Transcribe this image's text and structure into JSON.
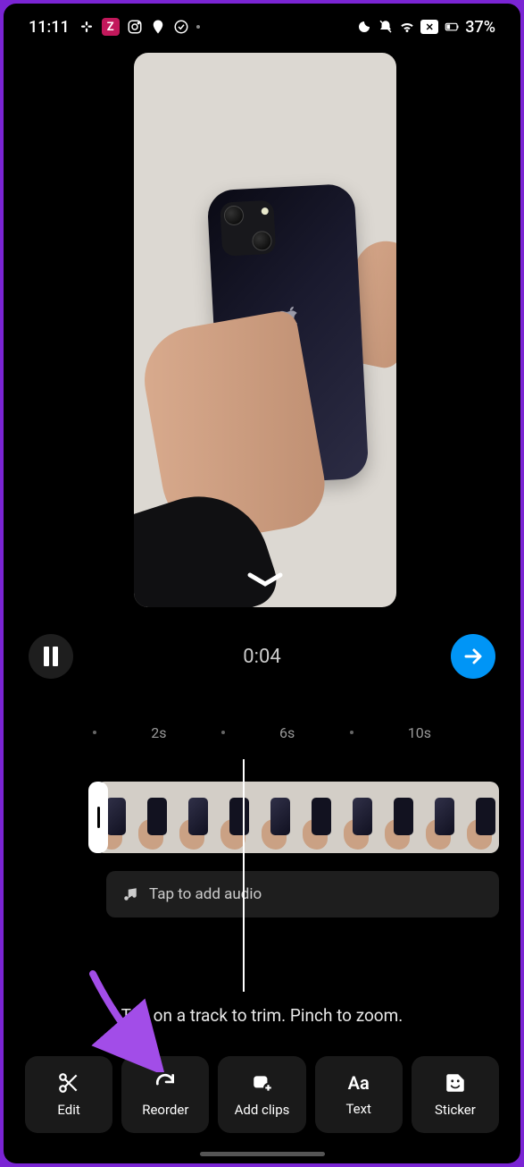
{
  "statusbar": {
    "time": "11:11",
    "z_label": "Z",
    "battery_text": "37%"
  },
  "playback": {
    "current_time": "0:04"
  },
  "ruler": {
    "marks": [
      "2s",
      "6s",
      "10s"
    ]
  },
  "audio": {
    "prompt": "Tap to add audio"
  },
  "hint": "Tap on a track to trim. Pinch to zoom.",
  "tools": {
    "edit": "Edit",
    "reorder": "Reorder",
    "add_clips": "Add clips",
    "text": "Text",
    "sticker": "Sticker"
  }
}
